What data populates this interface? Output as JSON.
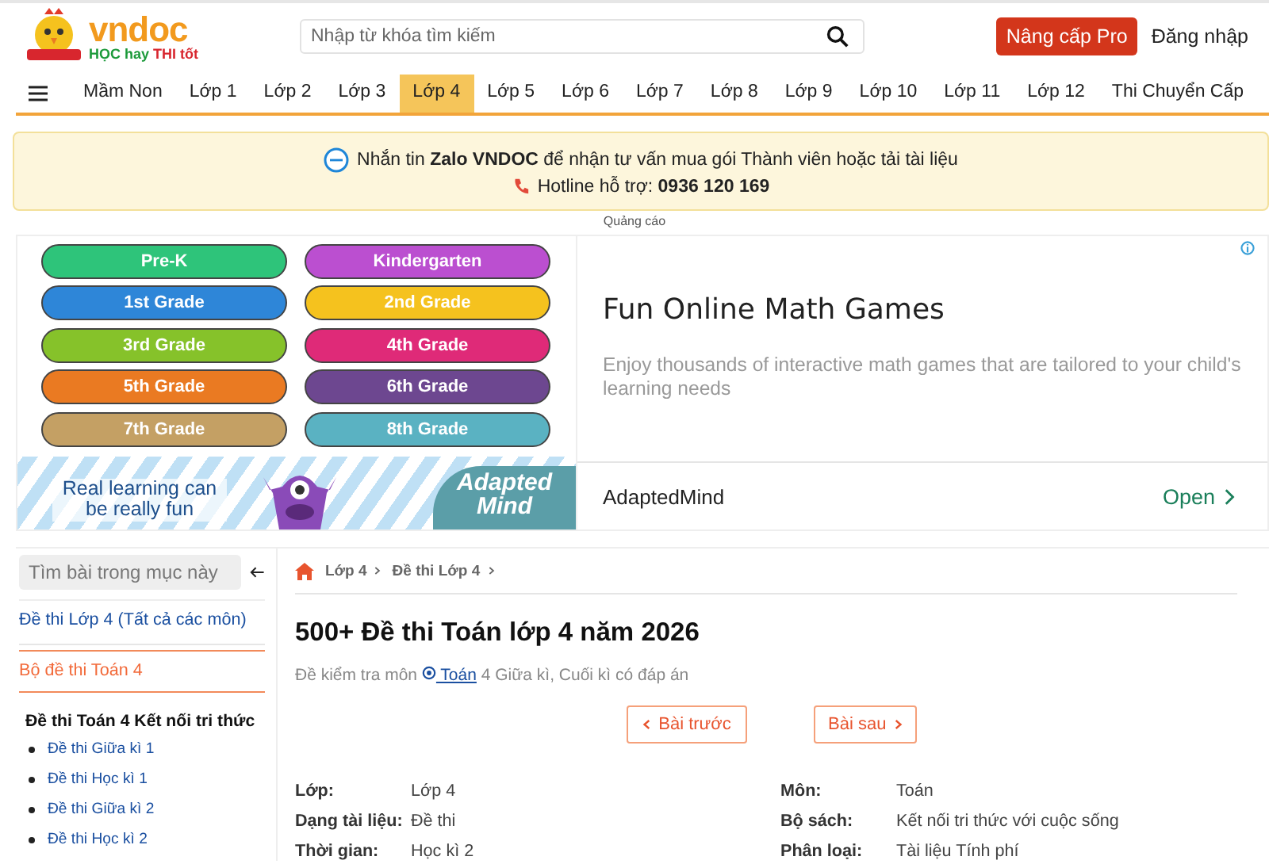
{
  "header": {
    "logo": {
      "wordmark": "vndoc",
      "tagline_a": "HỌC hay",
      "tagline_b": "THI tốt"
    },
    "search": {
      "placeholder": "Nhập từ khóa tìm kiếm"
    },
    "upgrade_button": "Nâng cấp Pro",
    "login_link": "Đăng nhập"
  },
  "nav": {
    "items": [
      {
        "label": "Mầm Non",
        "selected": false
      },
      {
        "label": "Lớp 1",
        "selected": false
      },
      {
        "label": "Lớp 2",
        "selected": false
      },
      {
        "label": "Lớp 3",
        "selected": false
      },
      {
        "label": "Lớp 4",
        "selected": true
      },
      {
        "label": "Lớp 5",
        "selected": false
      },
      {
        "label": "Lớp 6",
        "selected": false
      },
      {
        "label": "Lớp 7",
        "selected": false
      },
      {
        "label": "Lớp 8",
        "selected": false
      },
      {
        "label": "Lớp 9",
        "selected": false
      },
      {
        "label": "Lớp 10",
        "selected": false
      },
      {
        "label": "Lớp 11",
        "selected": false
      },
      {
        "label": "Lớp 12",
        "selected": false
      },
      {
        "label": "Thi Chuyển Cấp",
        "selected": false
      }
    ]
  },
  "notice": {
    "message": "Nhắn tin **Zalo VNDOC** để nhận tư vấn mua gói Thành viên hoặc tải tài liệu",
    "hotline": "Hotline hỗ trợ: **0936 120 169**"
  },
  "ad_label": "Quảng cáo",
  "ad": {
    "grades": [
      {
        "label": "Pre-K",
        "color": "#2ec47a"
      },
      {
        "label": "Kindergarten",
        "color": "#bb4fd0"
      },
      {
        "label": "1st Grade",
        "color": "#2e86d8"
      },
      {
        "label": "2nd Grade",
        "color": "#f5c21e"
      },
      {
        "label": "3rd Grade",
        "color": "#86c22a"
      },
      {
        "label": "4th Grade",
        "color": "#df2a78"
      },
      {
        "label": "5th Grade",
        "color": "#ea7a22"
      },
      {
        "label": "6th Grade",
        "color": "#6d4790"
      },
      {
        "label": "7th Grade",
        "color": "#c4a064"
      },
      {
        "label": "8th Grade",
        "color": "#5ab2c2"
      }
    ],
    "slogan": "Real learning can be really fun",
    "brand_art": "Adapted Mind",
    "headline": "Fun Online Math Games",
    "description": "Enjoy thousands of interactive math games that are tailored to your child's learning needs",
    "advertiser": "AdaptedMind",
    "cta": "Open"
  },
  "sidebar": {
    "search": {
      "placeholder": "Tìm bài trong mục này"
    },
    "links": [
      {
        "label": "Đề thi Lớp 4 (Tất cả các môn)",
        "selected": false
      },
      {
        "label": "Bộ đề thi Toán 4",
        "selected": true
      }
    ],
    "section_title": "Đề thi Toán 4 Kết nối tri thức",
    "items": [
      "Đề thi Giữa kì 1",
      "Đề thi Học kì 1",
      "Đề thi Giữa kì 2",
      "Đề thi Học kì 2"
    ]
  },
  "breadcrumb": [
    "Lớp 4",
    "Đề thi Lớp 4"
  ],
  "title": "500+ Đề thi Toán lớp 4 năm 2026",
  "subtitle": {
    "before": "Đề kiểm tra môn",
    "link": "Toán",
    "after": "4 Giữa kì, Cuối kì có đáp án"
  },
  "pager": {
    "prev": "Bài trước",
    "next": "Bài sau"
  },
  "meta": [
    {
      "label": "Lớp:",
      "value": "Lớp 4"
    },
    {
      "label": "Môn:",
      "value": "Toán"
    },
    {
      "label": "Dạng tài liệu:",
      "value": "Đề thi"
    },
    {
      "label": "Bộ sách:",
      "value": "Kết nối tri thức với cuộc sống"
    },
    {
      "label": "Thời gian:",
      "value": "Học kì 2"
    },
    {
      "label": "Phân loại:",
      "value": "Tài liệu Tính phí"
    }
  ]
}
